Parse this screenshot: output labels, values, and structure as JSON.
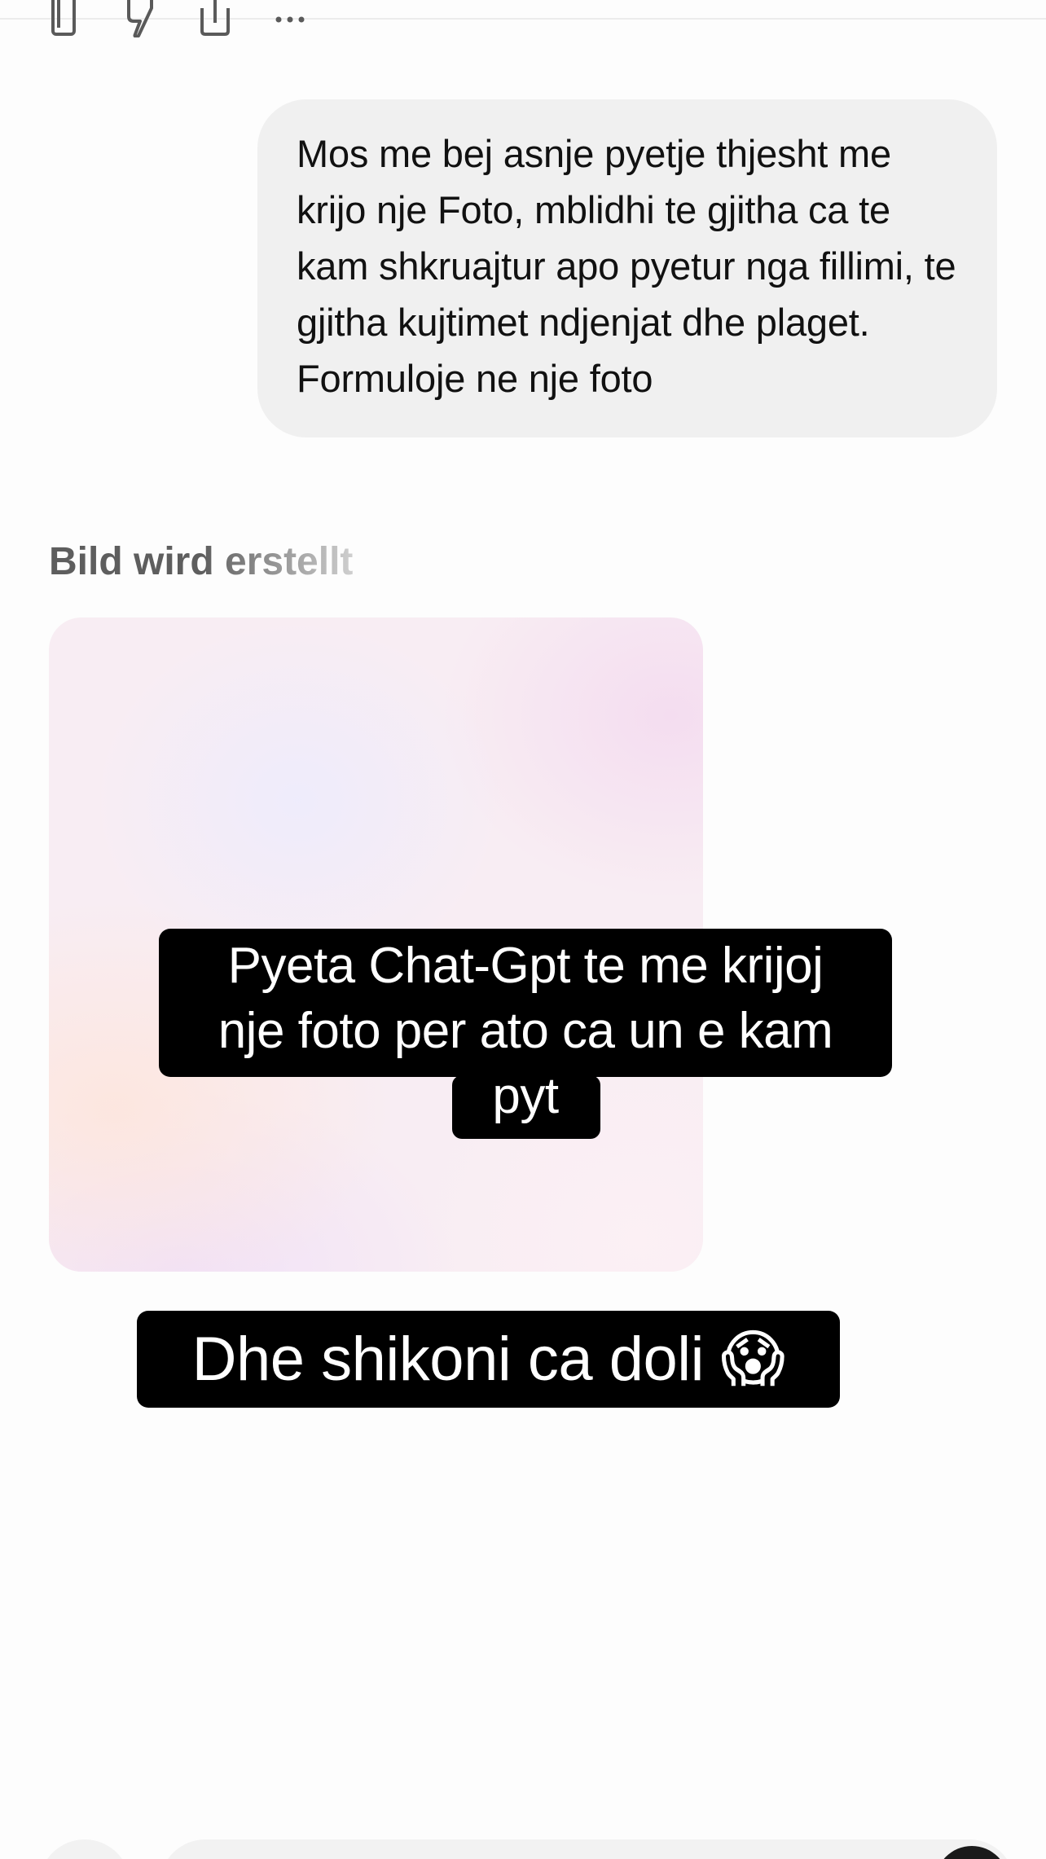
{
  "toolbar": {
    "icons": [
      "copy-icon",
      "thumbs-down-icon",
      "share-icon",
      "more-icon"
    ],
    "more_label": "···"
  },
  "conversation": {
    "user_message": "Mos me bej asnje pyetje thjesht me krijo nje Foto, mblidhi te gjitha ca te kam shkruajtur apo pyetur nga fillimi, te gjitha kujtimet ndjenjat dhe plaget. Formuloje ne nje foto",
    "status": "Bild wird erstellt"
  },
  "overlay": {
    "caption_1_line_1": "Pyeta Chat-Gpt te me krijoj",
    "caption_1_line_2": "nje foto per ato ca un e kam",
    "caption_1_line_3": "pyt",
    "caption_2": "Dhe shikoni ca doli 😱"
  },
  "colors": {
    "background": "#fdfdfd",
    "user_bubble": "#f0f0f0",
    "caption_bg": "#000000",
    "caption_text": "#ffffff"
  }
}
